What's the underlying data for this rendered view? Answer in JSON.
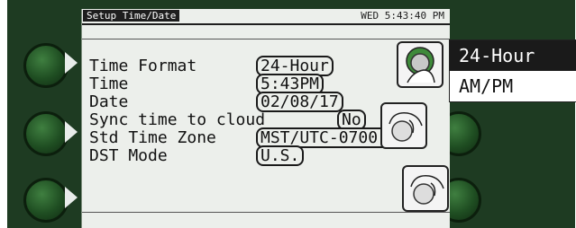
{
  "header": {
    "title": "Setup Time/Date",
    "clock": "WED 5:43:40 PM"
  },
  "settings": [
    {
      "label": "Time Format",
      "value": "24-Hour"
    },
    {
      "label": "Time",
      "value": "5:43PM"
    },
    {
      "label": "Date",
      "value": "02/08/17"
    },
    {
      "label": "Sync time to cloud",
      "value": "No"
    },
    {
      "label": "Std Time Zone",
      "value": "MST/UTC-0700"
    },
    {
      "label": "DST Mode",
      "value": "U.S."
    }
  ],
  "popup": {
    "options": [
      "24-Hour",
      "AM/PM"
    ],
    "selected": "24-Hour"
  },
  "colors": {
    "panel": "#1e3b22",
    "screen": "#ecefeb",
    "softkey": "#2f6b32"
  }
}
